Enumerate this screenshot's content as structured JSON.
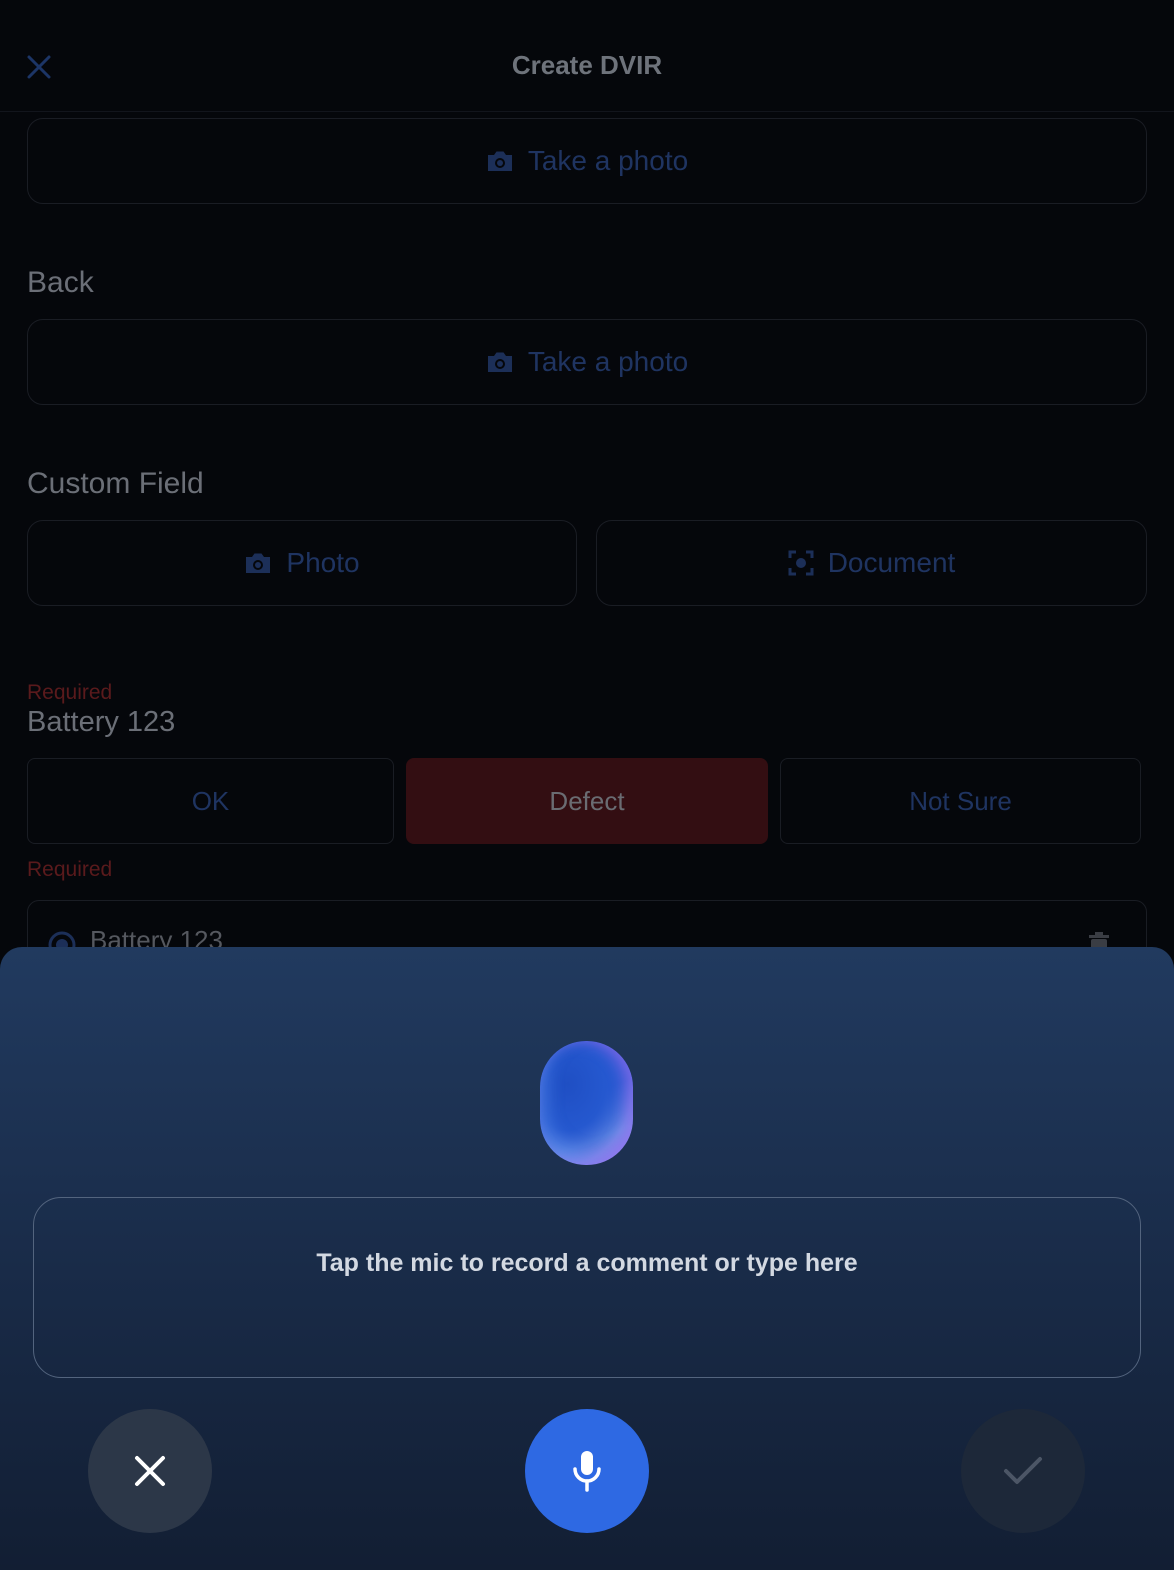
{
  "header": {
    "title": "Create DVIR",
    "close_icon": "close-icon"
  },
  "photo_sections": [
    {
      "label": "",
      "button_label": "Take a photo",
      "icon": "camera-icon"
    },
    {
      "label": "Back",
      "button_label": "Take a photo",
      "icon": "camera-icon"
    }
  ],
  "custom_field": {
    "label": "Custom Field",
    "photo_label": "Photo",
    "document_label": "Document"
  },
  "inspection_item": {
    "required_label": "Required",
    "name": "Battery 123",
    "options": [
      "OK",
      "Defect",
      "Not Sure"
    ],
    "selected": "Defect",
    "defect_required_label": "Required",
    "defect_entry_label": "Battery 123"
  },
  "comment_sheet": {
    "placeholder": "Tap the mic to record a comment or type here",
    "cancel_icon": "close-icon",
    "mic_icon": "microphone-icon",
    "confirm_icon": "check-icon"
  },
  "colors": {
    "accent": "#2e69e3",
    "defect": "#330e12",
    "sheet_top": "#213a5f",
    "sheet_bottom": "#121e33"
  }
}
